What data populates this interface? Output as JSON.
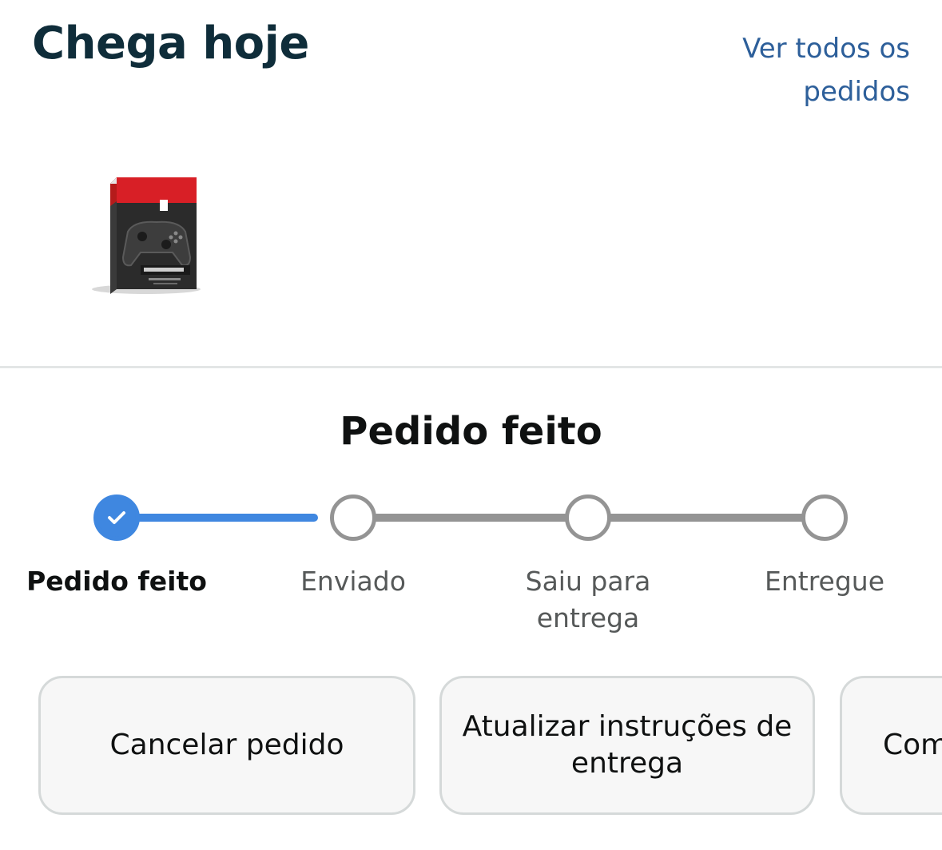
{
  "header": {
    "title": "Chega hoje",
    "view_all_label": "Ver todos os pedidos"
  },
  "product": {
    "image_icon": "game-controller-box"
  },
  "status": {
    "title": "Pedido feito"
  },
  "progress": {
    "current_step": 1,
    "steps": [
      {
        "label": "Pedido feito",
        "state": "done"
      },
      {
        "label": "Enviado",
        "state": "pending"
      },
      {
        "label": "Saiu para entrega",
        "state": "pending"
      },
      {
        "label": "Entregue",
        "state": "pending"
      }
    ]
  },
  "actions": [
    {
      "label": "Cancelar pedido"
    },
    {
      "label": "Atualizar instruções de entrega"
    },
    {
      "label": "Com"
    }
  ],
  "colors": {
    "heading": "#0f2d3a",
    "link": "#2d5f9a",
    "progress_done": "#3f87e0",
    "progress_pending": "#949494",
    "button_bg": "#f7f7f7",
    "button_border": "#d5d9d9"
  }
}
